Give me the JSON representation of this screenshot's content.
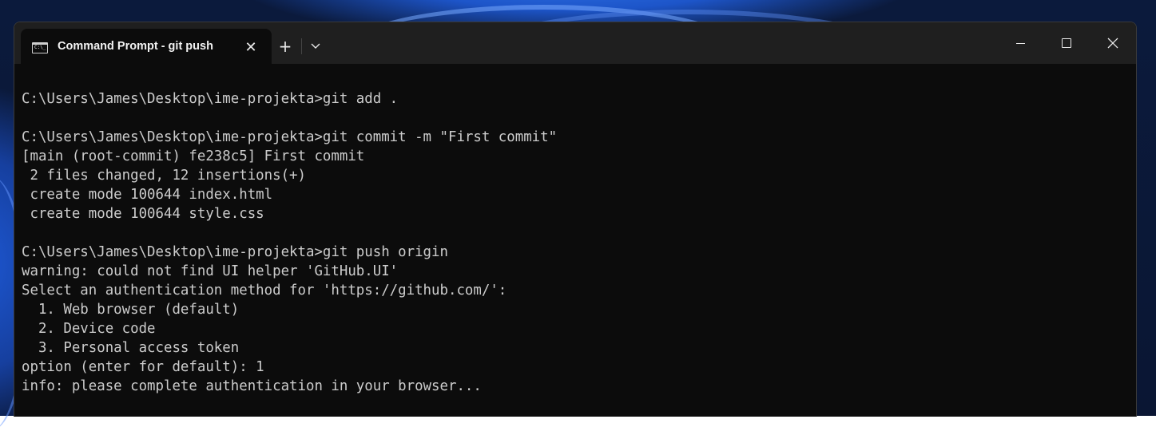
{
  "window": {
    "tab_title": "Command Prompt - git  push",
    "tab_icon_text": "C:\\_",
    "tab_close_glyph": "✕",
    "new_tab_glyph": "+",
    "dropdown_icon": "chevron-down-icon",
    "minimize_icon": "minimize-icon",
    "maximize_icon": "maximize-icon",
    "close_glyph": "✕"
  },
  "colors": {
    "console_bg": "#0c0c0c",
    "console_text": "#cccccc",
    "titlebar_bg": "#1f1f1f"
  },
  "console": {
    "lines": [
      "C:\\Users\\James\\Desktop\\ime-projekta>git add .",
      "",
      "C:\\Users\\James\\Desktop\\ime-projekta>git commit -m \"First commit\"",
      "[main (root-commit) fe238c5] First commit",
      " 2 files changed, 12 insertions(+)",
      " create mode 100644 index.html",
      " create mode 100644 style.css",
      "",
      "C:\\Users\\James\\Desktop\\ime-projekta>git push origin",
      "warning: could not find UI helper 'GitHub.UI'",
      "Select an authentication method for 'https://github.com/':",
      "  1. Web browser (default)",
      "  2. Device code",
      "  3. Personal access token",
      "option (enter for default): 1",
      "info: please complete authentication in your browser..."
    ]
  }
}
